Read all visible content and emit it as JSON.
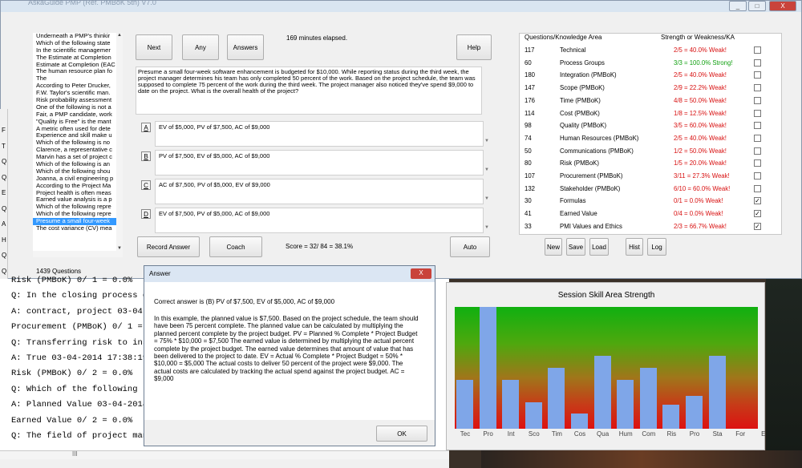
{
  "window": {
    "title": "AskaGuide PMP (Ref. PMBoK 5th) V7.0",
    "min_label": "_",
    "max_label": "□",
    "close_label": "X"
  },
  "question_list": {
    "items": [
      "Underneath a PMP's thinkir",
      "Which of the following state",
      "In the scientific managemer",
      "The Estimate at Completion",
      "Estimate at Completion (EAC",
      "The human resource plan fo",
      "The",
      "According to Peter Drucker,",
      "F.W. Taylor's scientific man.",
      "Risk probability assessment",
      "One of the following is not a",
      "Fair, a PMP candidate, work",
      "\"Quality is Free\" is the mant",
      "A metric often used for dete",
      "Experience and skill make u",
      "Which of the following is no",
      "Clarence, a representative c",
      "Marvin has a set of project c",
      "Which of the following is an",
      "Which of the following shou",
      "Joanna, a civil engineering p",
      "According to the Project Ma",
      "Project health is often meas",
      "Earned value analysis is a p",
      "Which of the following repre",
      "Which of the following repre",
      "Presume a small four-week",
      "The cost variance (CV) mea"
    ],
    "selected_index": 26,
    "count_label": "1439 Questions"
  },
  "buttons": {
    "next": "Next",
    "any": "Any",
    "answers": "Answers",
    "help": "Help",
    "record_answer": "Record Answer",
    "coach": "Coach",
    "auto": "Auto",
    "new": "New",
    "save": "Save",
    "load": "Load",
    "hist": "Hist",
    "log": "Log"
  },
  "elapsed": "169 minutes elapsed.",
  "question_text": "Presume a small four-week software enhancement is budgeted for $10,000. While reporting status during the third week, the project manager determines his team has only completed 50 percent of the work. Based on the project schedule, the team was supposed to complete 75 percent of the work during the third week. The project manager also noticed they've spend $9,000 to date on the project. What is the overall health of the project?",
  "choices": [
    {
      "letter": "A",
      "text": "EV of $5,000, PV of $7,500, AC of $9,000"
    },
    {
      "letter": "B",
      "text": "PV of $7,500, EV of $5,000, AC of $9,000"
    },
    {
      "letter": "C",
      "text": "AC of $7,500, PV of $5,000, EV of $9,000"
    },
    {
      "letter": "D",
      "text": "EV of $7,500, PV of $5,000, AC of $9,000"
    }
  ],
  "score_text": "Score = 32/ 84 = 38.1%",
  "ka_table": {
    "header_left": "Questions/Knowledge Area",
    "header_right": "Strength or Weakness/KA",
    "rows": [
      {
        "count": "117",
        "area": "Technical",
        "strength": "2/5 = 40.0%  Weak!",
        "checked": "",
        "color": "#d81010"
      },
      {
        "count": "60",
        "area": "Process Groups",
        "strength": "3/3 = 100.0%  Strong!",
        "checked": "",
        "color": "#10a010"
      },
      {
        "count": "180",
        "area": "Integration (PMBoK)",
        "strength": "2/5 = 40.0%  Weak!",
        "checked": "",
        "color": "#d81010"
      },
      {
        "count": "147",
        "area": "Scope (PMBoK)",
        "strength": "2/9 = 22.2%  Weak!",
        "checked": "",
        "color": "#d81010"
      },
      {
        "count": "176",
        "area": "Time (PMBoK)",
        "strength": "4/8 = 50.0%  Weak!",
        "checked": "",
        "color": "#d81010"
      },
      {
        "count": "114",
        "area": "Cost (PMBoK)",
        "strength": "1/8 = 12.5%  Weak!",
        "checked": "",
        "color": "#d81010"
      },
      {
        "count": "98",
        "area": "Quality (PMBoK)",
        "strength": "3/5 = 60.0%  Weak!",
        "checked": "",
        "color": "#d81010"
      },
      {
        "count": "74",
        "area": "Human Resources (PMBoK)",
        "strength": "2/5 = 40.0%  Weak!",
        "checked": "",
        "color": "#d81010"
      },
      {
        "count": "50",
        "area": "Communications (PMBoK)",
        "strength": "1/2 = 50.0%  Weak!",
        "checked": "",
        "color": "#d81010"
      },
      {
        "count": "80",
        "area": "Risk (PMBoK)",
        "strength": "1/5 = 20.0%  Weak!",
        "checked": "",
        "color": "#d81010"
      },
      {
        "count": "107",
        "area": "Procurement (PMBoK)",
        "strength": "3/11 = 27.3%  Weak!",
        "checked": "",
        "color": "#d81010"
      },
      {
        "count": "132",
        "area": "Stakeholder (PMBoK)",
        "strength": "6/10 = 60.0%  Weak!",
        "checked": "",
        "color": "#d81010"
      },
      {
        "count": "30",
        "area": "Formulas",
        "strength": "0/1 = 0.0%  Weak!",
        "checked": "✓",
        "color": "#d81010"
      },
      {
        "count": "41",
        "area": "Earned Value",
        "strength": "0/4 = 0.0%  Weak!",
        "checked": "✓",
        "color": "#d81010"
      },
      {
        "count": "33",
        "area": "PMI Values and Ethics",
        "strength": "2/3 = 66.7%  Weak!",
        "checked": "✓",
        "color": "#d81010"
      }
    ]
  },
  "console_lines": [
    "Risk (PMBoK) 0/ 1 = 0.0%",
    "Q: In the closing process gr",
    "A: contract, project 03-04-2",
    "Procurement (PMBoK) 0/ 1 = 0",
    "Q: Transferring risk to insu",
    "A: True 03-04-2014 17:38:19",
    "Risk (PMBoK) 0/ 2 = 0.0%",
    "Q: Which of the following re",
    "A: Planned Value 03-04-2014",
    "Earned Value 0/ 2 = 0.0%",
    "Q: The field of project mana"
  ],
  "left_strip_letters": [
    "F",
    "T",
    "Q",
    "Q",
    "E",
    "Q",
    "A",
    "H",
    "Q",
    "Q"
  ],
  "dialog": {
    "title": "Answer",
    "close_label": "X",
    "correct": "Correct answer is  (B)  PV of $7,500, EV of $5,000, AC of $9,000",
    "explanation": "In this example, the planned value is $7,500. Based on the project schedule, the team should have been 75 percent complete. The planned value can be calculated by multiplying the planned percent complete by the project budget. PV = Planned % Complete * Project Budget = 75% * $10,000 = $7,500  The earned value is determined by multiplying the actual percent complete by the project budget. The earned value determines that amount of value that has been delivered to the project to date.  EV = Actual % Complete * Project Budget = 50% * $10,000 = $5,000  The actual costs to deliver 50 percent of the project were $9,000. The actual costs are calculated by tracking the actual spend against the project budget.  AC = $9,000",
    "ok_label": "OK"
  },
  "chart_data": {
    "type": "bar",
    "title": "Session Skill Area Strength",
    "categories": [
      "Tec",
      "Pro",
      "Int",
      "Sco",
      "Tim",
      "Cos",
      "Qua",
      "Hum",
      "Com",
      "Ris",
      "Pro",
      "Sta",
      "For",
      "E"
    ],
    "values": [
      0.4,
      1.0,
      0.4,
      0.22,
      0.5,
      0.125,
      0.6,
      0.4,
      0.5,
      0.2,
      0.273,
      0.6,
      0,
      0
    ],
    "ylim": [
      0,
      1
    ],
    "grid": false
  },
  "scroll_glyph": "III"
}
